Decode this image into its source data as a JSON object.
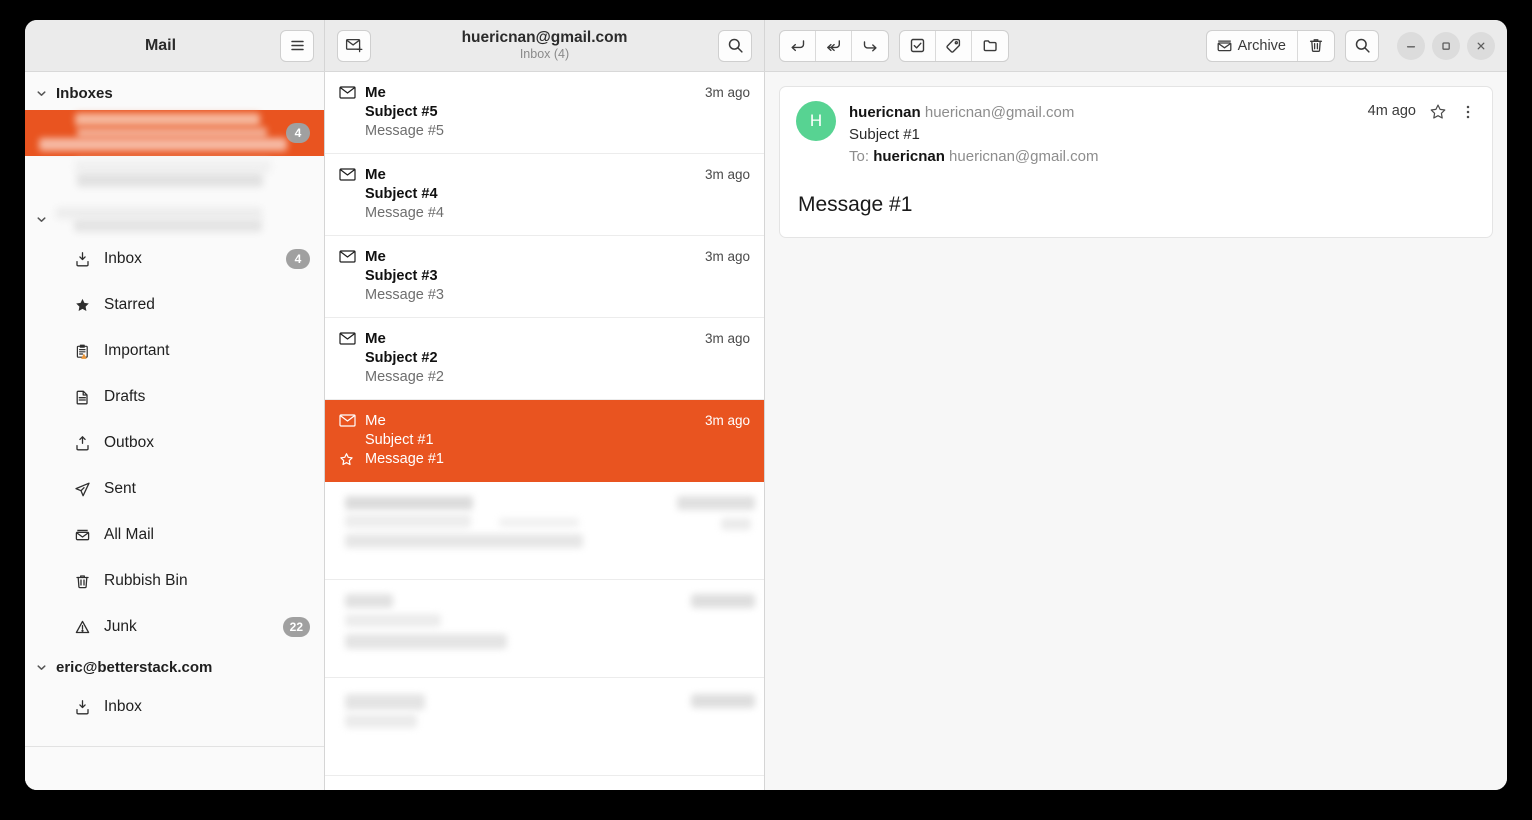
{
  "window": {
    "controls": {
      "minimize": "minimize-button",
      "maximize": "maximize-button",
      "close": "close-button"
    }
  },
  "sidebar": {
    "title": "Mail",
    "menu_button": "hamburger-menu",
    "groups": [
      {
        "label": "Inboxes",
        "expanded": true,
        "redacted_items": [
          {
            "selected": true,
            "badge": "4"
          },
          {
            "selected": false,
            "badge": ""
          }
        ]
      },
      {
        "label": "",
        "redacted": true,
        "expanded": true
      }
    ],
    "items": [
      {
        "label": "Inbox",
        "icon": "inbox-icon",
        "badge": "4"
      },
      {
        "label": "Starred",
        "icon": "star-icon",
        "badge": ""
      },
      {
        "label": "Important",
        "icon": "important-icon",
        "badge": ""
      },
      {
        "label": "Drafts",
        "icon": "document-icon",
        "badge": ""
      },
      {
        "label": "Outbox",
        "icon": "outbox-icon",
        "badge": ""
      },
      {
        "label": "Sent",
        "icon": "send-icon",
        "badge": ""
      },
      {
        "label": "All Mail",
        "icon": "mail-stack-icon",
        "badge": ""
      },
      {
        "label": "Rubbish Bin",
        "icon": "trash-icon",
        "badge": ""
      },
      {
        "label": "Junk",
        "icon": "warning-icon",
        "badge": "22"
      }
    ],
    "account_group": {
      "label": "eric@betterstack.com",
      "items": [
        {
          "label": "Inbox",
          "icon": "inbox-icon",
          "badge": ""
        }
      ]
    }
  },
  "message_list": {
    "header": {
      "title": "huericnan@gmail.com",
      "subtitle": "Inbox (4)",
      "compose_button": "compose-icon",
      "search_button": "search-icon"
    },
    "messages": [
      {
        "from": "Me",
        "subject": "Subject #5",
        "preview": "Message #5",
        "time": "3m ago",
        "selected": false,
        "starred": false
      },
      {
        "from": "Me",
        "subject": "Subject #4",
        "preview": "Message #4",
        "time": "3m ago",
        "selected": false,
        "starred": false
      },
      {
        "from": "Me",
        "subject": "Subject #3",
        "preview": "Message #3",
        "time": "3m ago",
        "selected": false,
        "starred": false
      },
      {
        "from": "Me",
        "subject": "Subject #2",
        "preview": "Message #2",
        "time": "3m ago",
        "selected": false,
        "starred": false
      },
      {
        "from": "Me",
        "subject": "Subject #1",
        "preview": "Message #1",
        "time": "3m ago",
        "selected": true,
        "starred": true
      }
    ],
    "redacted_count": 3
  },
  "toolbar": {
    "reply": "reply-icon",
    "reply_all": "reply-all-icon",
    "forward": "forward-icon",
    "mark_read": "mark-read-icon",
    "tag": "tag-icon",
    "move_folder": "folder-icon",
    "archive_label": "Archive",
    "delete": "trash-icon",
    "search": "search-icon"
  },
  "reader": {
    "avatar_initial": "H",
    "from_name": "huericnan",
    "from_address": "huericnan@gmail.com",
    "subject": "Subject #1",
    "to_label": "To:",
    "to_name": "huericnan",
    "to_address": "huericnan@gmail.com",
    "time": "4m ago",
    "star_button": "star-icon",
    "more_button": "more-vertical-icon",
    "body": "Message #1"
  },
  "colors": {
    "accent": "#e95420",
    "avatar": "#57d392",
    "badge": "#a0a0a0",
    "headerbar": "#ebebeb"
  }
}
